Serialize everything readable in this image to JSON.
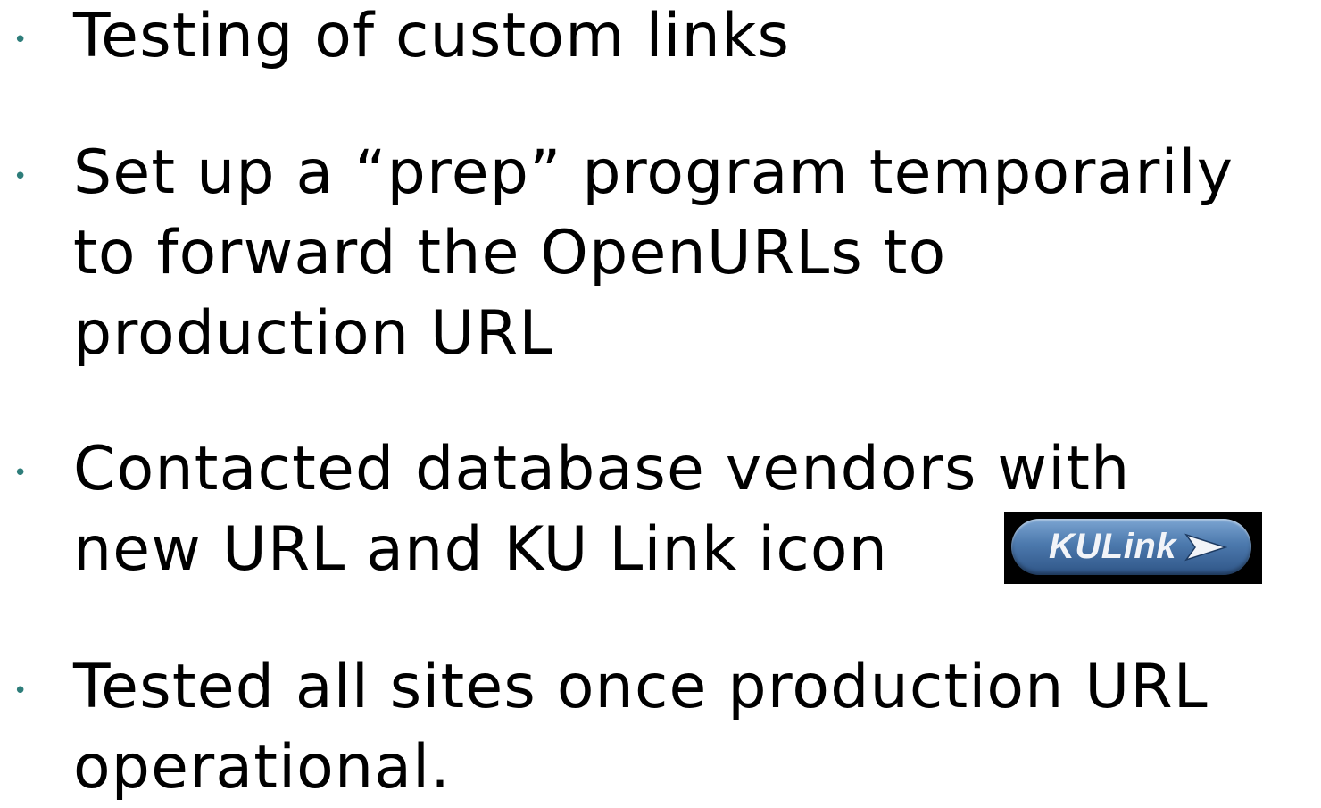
{
  "bullets": [
    {
      "lines": [
        "Testing of custom links"
      ]
    },
    {
      "lines": [
        "Set up a “prep” program temporarily",
        "to forward the OpenURLs to",
        "production URL"
      ]
    },
    {
      "lines": [
        "Contacted database vendors with",
        "new URL and KU Link icon"
      ]
    },
    {
      "lines": [
        "Tested all sites once production URL",
        "operational."
      ]
    }
  ],
  "bullet_glyph": "•",
  "badge": {
    "label": "KULink",
    "icon": "arrow-right-icon"
  },
  "colors": {
    "bullet": "#2e7d7a",
    "text": "#000000",
    "badge_bg": "#000000",
    "badge_pill": "#4c79ad"
  }
}
